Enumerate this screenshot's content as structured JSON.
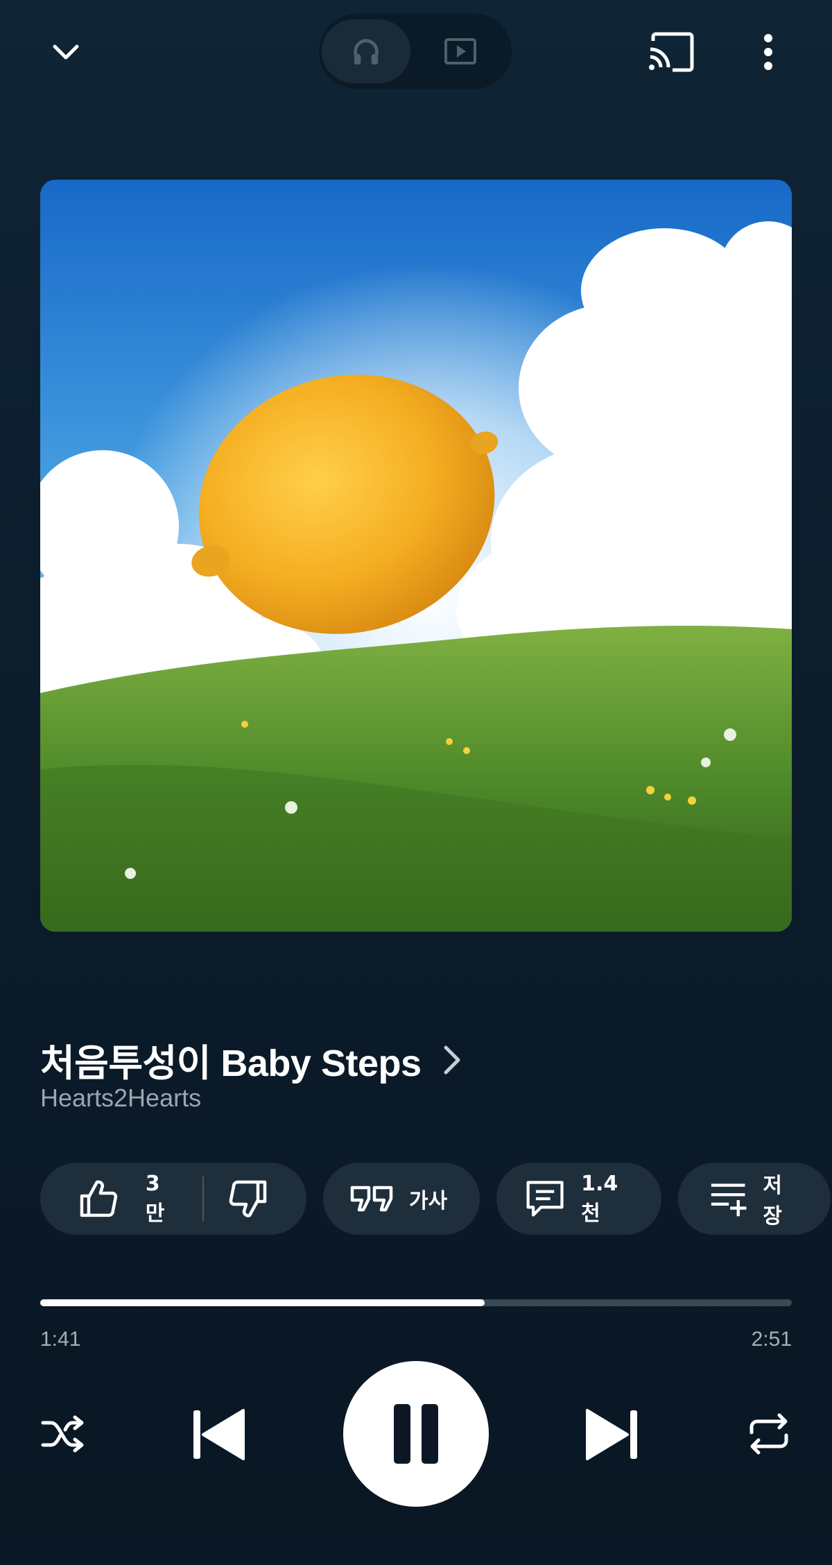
{
  "topbar": {
    "collapse_icon": "chevron-down-icon",
    "toggle": [
      {
        "icon": "headphones-icon",
        "active": true
      },
      {
        "icon": "video-icon",
        "active": false
      }
    ],
    "cast_icon": "cast-icon",
    "more_icon": "more-vert-icon"
  },
  "track": {
    "title": "처음투성이 Baby Steps",
    "artist": "Hearts2Hearts"
  },
  "actions": {
    "like_count": "3만",
    "lyrics_label": "가사",
    "comments_count": "1.4천",
    "save_label": "저장"
  },
  "playback": {
    "current_time": "1:41",
    "total_time": "2:51",
    "progress_fraction": 0.591
  },
  "colors": {
    "background": "#0c1d2c",
    "chip": "#1f2e3b",
    "progress_track": "#3a4954",
    "progress_fill": "#ffffff"
  }
}
